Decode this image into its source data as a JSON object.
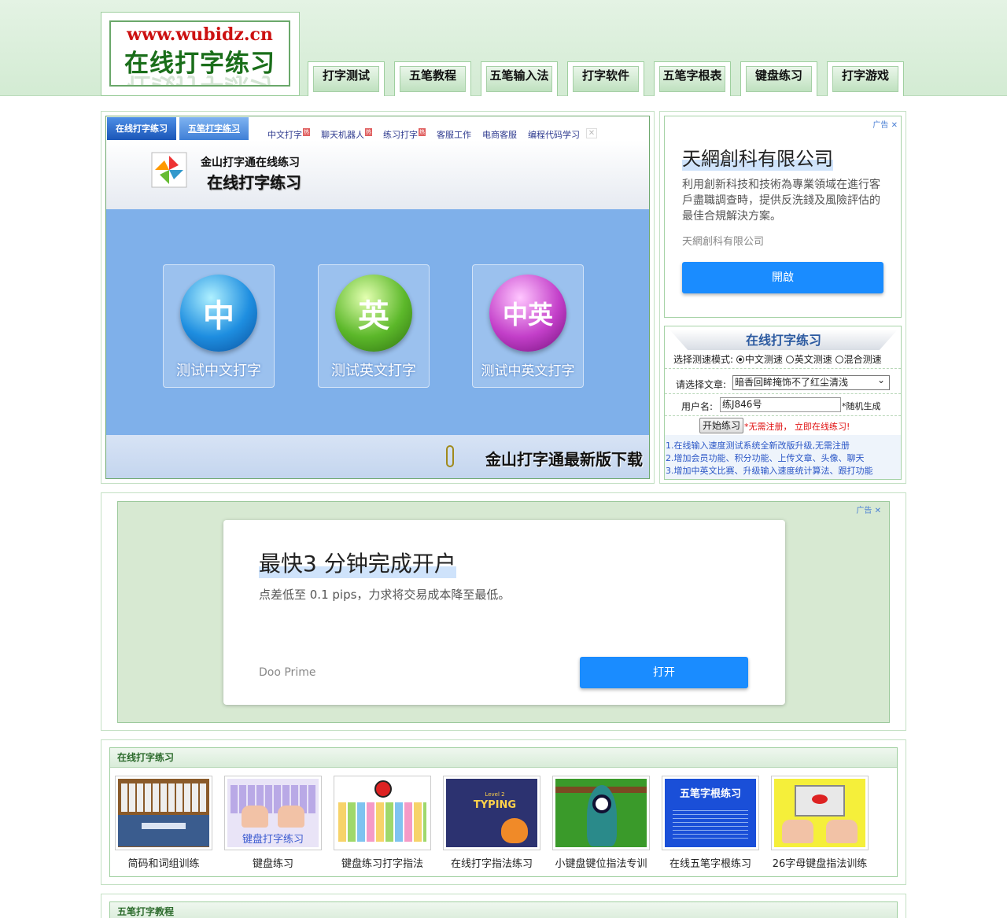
{
  "site": {
    "logo_url": "www.wubidz.cn",
    "logo_title": "在线打字练习"
  },
  "nav": [
    "打字测试",
    "五笔教程",
    "五笔输入法",
    "打字软件",
    "五笔字根表",
    "键盘练习",
    "打字游戏"
  ],
  "app": {
    "tabs": [
      "在线打字练习",
      "五笔打字练习"
    ],
    "links": [
      {
        "label": "中文打字",
        "hot": "热"
      },
      {
        "label": "聊天机器人",
        "hot": "热"
      },
      {
        "label": "练习打字",
        "hot": "热"
      },
      {
        "label": "客服工作",
        "hot": ""
      },
      {
        "label": "电商客服",
        "hot": ""
      },
      {
        "label": "编程代码学习",
        "hot": ""
      }
    ],
    "subtitle": "金山打字通在线练习",
    "title": "在线打字练习",
    "cards": [
      {
        "glyph": "中",
        "label": "测试中文打字",
        "color": "#1e8ee0"
      },
      {
        "glyph": "英",
        "label": "测试英文打字",
        "color": "#5cb82a"
      },
      {
        "glyph": "中英",
        "label": "测试中英文打字",
        "color": "#c33fc9"
      }
    ],
    "download": "金山打字通最新版下载"
  },
  "ad1": {
    "badge": "广告",
    "title": "天網創科有限公司",
    "text": "利用創新科技和技術為專業領域在進行客戶盡職調查時，提供反洗錢及風險評估的最佳合規解決方案。",
    "source": "天網創科有限公司",
    "button": "開啟"
  },
  "form": {
    "title": "在线打字练习",
    "mode_label": "选择测速模式:",
    "modes": [
      "中文测速",
      "英文测速",
      "混合测速"
    ],
    "article_label": "请选择文章:",
    "article_value": "暗香回眸掩饰不了红尘清浅",
    "user_label": "用户名:",
    "user_value": "练J846号",
    "user_note": "*随机生成",
    "start_button": "开始练习",
    "start_note": "*无需注册，  立即在线练习!",
    "notes": [
      "1.在线输入速度测试系统全新改版升级,无需注册",
      "2.增加会员功能、积分功能、上传文章、头像、聊天",
      "3.增加中英文比赛、升级输入速度统计算法、跟打功能"
    ]
  },
  "ad2": {
    "badge": "广告",
    "title": "最快3 分钟完成开户",
    "text": "点差低至 0.1 pips，力求将交易成本降至最低。",
    "source": "Doo Prime",
    "button": "打开"
  },
  "practice": {
    "title": "在线打字练习",
    "items": [
      "简码和词组训练",
      "键盘练习",
      "键盘练习打字指法",
      "在线打字指法练习",
      "小键盘键位指法专训",
      "在线五笔字根练习",
      "26字母键盘指法训练"
    ],
    "thumb_texts": {
      "keyboard": "键盘打字练习",
      "typing": "TYPING",
      "level": "Level 2",
      "zigen": "五笔字根练习"
    }
  },
  "wubi": {
    "title": "五笔打字教程"
  }
}
